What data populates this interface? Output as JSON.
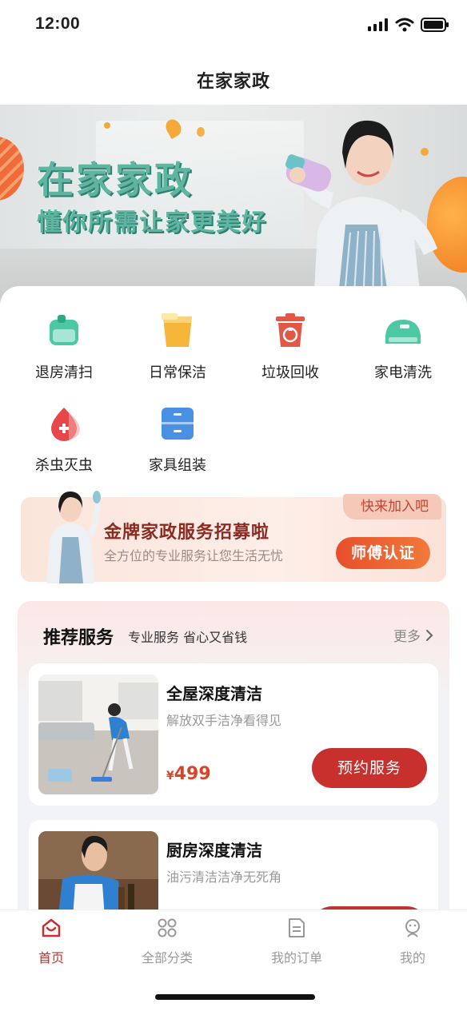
{
  "status": {
    "time": "12:00"
  },
  "nav": {
    "title": "在家家政"
  },
  "banner": {
    "title": "在家家政",
    "subtitle": "懂你所需让家更美好"
  },
  "categories": [
    {
      "label": "退房清扫",
      "icon": "checkout-clean-icon",
      "color": "#4cc9a3"
    },
    {
      "label": "日常保洁",
      "icon": "bucket-icon",
      "color": "#f5b63a"
    },
    {
      "label": "垃圾回收",
      "icon": "trash-recycle-icon",
      "color": "#e35746"
    },
    {
      "label": "家电清洗",
      "icon": "appliance-icon",
      "color": "#4cc9a3"
    },
    {
      "label": "杀虫灭虫",
      "icon": "pest-drop-icon",
      "color": "#e6484a"
    },
    {
      "label": "家具组装",
      "icon": "cabinet-icon",
      "color": "#4a90e2"
    }
  ],
  "recruit": {
    "tag": "快来加入吧",
    "title": "金牌家政服务招募啦",
    "subtitle": "全方位的专业服务让您生活无忧",
    "button": "师傅认证"
  },
  "recommend": {
    "title": "推荐服务",
    "desc": "专业服务 省心又省钱",
    "more": "更多",
    "services": [
      {
        "name": "全屋深度清洁",
        "desc": "解放双手洁净看得见",
        "currency": "¥",
        "price": "499",
        "button": "预约服务"
      },
      {
        "name": "厨房深度清洁",
        "desc": "油污清洁洁净无死角"
      }
    ]
  },
  "tabs": [
    {
      "label": "首页",
      "icon": "home-icon",
      "active": true
    },
    {
      "label": "全部分类",
      "icon": "grid-icon",
      "active": false
    },
    {
      "label": "我的订单",
      "icon": "order-icon",
      "active": false
    },
    {
      "label": "我的",
      "icon": "profile-icon",
      "active": false
    }
  ],
  "colors": {
    "accent": "#c8302e",
    "price": "#d6452a",
    "banner_text": "#5fb5a0"
  }
}
